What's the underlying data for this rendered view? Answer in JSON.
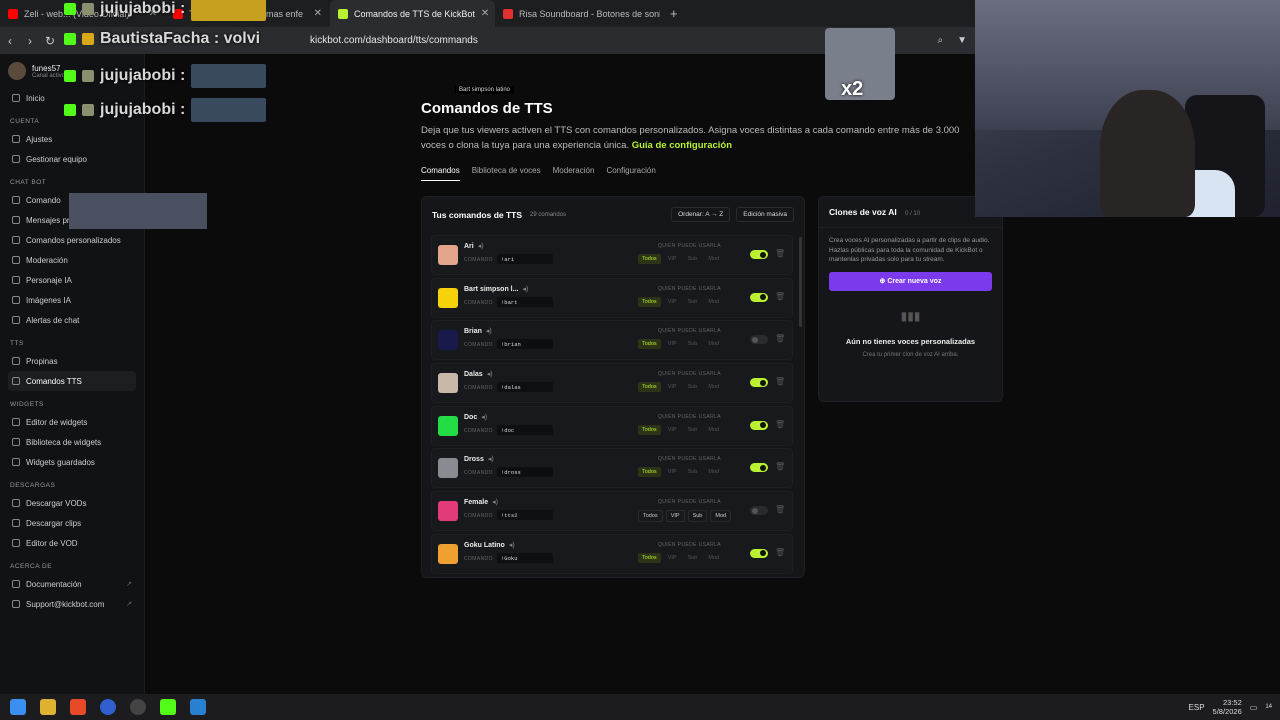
{
  "browser": {
    "tabs": [
      {
        "label": "Zeli - web... (Video Oficial)",
        "color": "#ff0000",
        "active": false
      },
      {
        "label": "THE CASINO... es mas enfe",
        "color": "#ff0000",
        "active": false
      },
      {
        "label": "Comandos de TTS de KickBot",
        "color": "#b9f232",
        "active": true
      },
      {
        "label": "Risa Soundboard - Botones de sonid",
        "color": "#e03131",
        "active": false
      }
    ],
    "url": "kickbot.com/dashboard/tts/commands"
  },
  "sidebar": {
    "user": {
      "name": "funes57",
      "sub": "Canal activo"
    },
    "items_top": [
      {
        "label": "Inicio",
        "icon": "home-icon"
      }
    ],
    "sections": [
      {
        "title": "CUENTA",
        "items": [
          {
            "label": "Ajustes"
          },
          {
            "label": "Gestionar equipo"
          }
        ]
      },
      {
        "title": "CHAT BOT",
        "items": [
          {
            "label": "Comando"
          },
          {
            "label": "Mensajes programados"
          },
          {
            "label": "Comandos personalizados"
          },
          {
            "label": "Moderación"
          },
          {
            "label": "Personaje IA"
          },
          {
            "label": "Imágenes IA"
          },
          {
            "label": "Alertas de chat"
          }
        ]
      },
      {
        "title": "TTS",
        "items": [
          {
            "label": "Propinas"
          },
          {
            "label": "Comandos TTS"
          }
        ]
      },
      {
        "title": "WIDGETS",
        "items": [
          {
            "label": "Editor de widgets"
          },
          {
            "label": "Biblioteca de widgets"
          },
          {
            "label": "Widgets guardados"
          }
        ]
      },
      {
        "title": "DESCARGAS",
        "items": [
          {
            "label": "Descargar VODs"
          },
          {
            "label": "Descargar clips"
          },
          {
            "label": "Editor de VOD"
          }
        ]
      },
      {
        "title": "ACERCA DE",
        "items": [
          {
            "label": "Documentación"
          },
          {
            "label": "Support@kickbot.com"
          }
        ]
      }
    ]
  },
  "main": {
    "tooltip": "Bart simpson latino",
    "title": "Comandos de TTS",
    "description": "Deja que tus viewers activen el TTS con comandos personalizados. Asigna voces distintas a cada comando entre más de 3.000 voces o clona la tuya para una experiencia única.",
    "guide_link": "Guía de configuración",
    "tabs": [
      "Comandos",
      "Biblioteca de voces",
      "Moderación",
      "Configuración"
    ]
  },
  "commands_panel": {
    "title": "Tus comandos de TTS",
    "count": "29 comandos",
    "sort_label": "Ordenar: A → Z",
    "bulk_label": "Edición masiva",
    "command_label": "COMANDO",
    "who_label": "QUIÉN PUEDE USARLA",
    "perm_labels": [
      "Todos",
      "VIP",
      "Sub",
      "Mod"
    ],
    "rows": [
      {
        "name": "Ari",
        "cmd": "!ari",
        "enabled": true,
        "all": false,
        "color": "#e3a58a"
      },
      {
        "name": "Bart simpson l...",
        "cmd": "!bart",
        "enabled": true,
        "all": false,
        "color": "#f5d20a"
      },
      {
        "name": "Brian",
        "cmd": "!brian",
        "enabled": false,
        "all": false,
        "color": "#1a1a4a"
      },
      {
        "name": "Dalas",
        "cmd": "!dalas",
        "enabled": true,
        "all": false,
        "color": "#c9b8a8"
      },
      {
        "name": "Doc",
        "cmd": "!doc",
        "enabled": true,
        "all": false,
        "color": "#22dd44"
      },
      {
        "name": "Dross",
        "cmd": "!dross",
        "enabled": true,
        "all": false,
        "color": "#8a8a92"
      },
      {
        "name": "Female",
        "cmd": "!tts2",
        "enabled": false,
        "all": true,
        "color": "#e33b7a"
      },
      {
        "name": "Goku Latino",
        "cmd": "!Goku",
        "enabled": true,
        "all": false,
        "color": "#f0a030"
      }
    ]
  },
  "voice_panel": {
    "title": "Clones de voz AI",
    "count": "0 / 10",
    "description": "Crea voces AI personalizadas a partir de clips de audio. Hazlas públicas para toda la comunidad de KickBot o mantenlas privadas solo para tu stream.",
    "button": "Crear nueva voz",
    "empty_title": "Aún no tienes voces personalizadas",
    "empty_sub": "Crea tu primer clon de voz AI arriba."
  },
  "overlay": {
    "chat": [
      {
        "user": "jujujabobi :"
      },
      {
        "user": "BautistaFacha : volvi"
      },
      {
        "user": "jujujabobi :"
      },
      {
        "user": "jujujabobi :"
      }
    ],
    "x2": "x2"
  },
  "taskbar": {
    "lang": "ESP",
    "time": "23:52",
    "date": "5/8/2026",
    "notif": "14"
  }
}
